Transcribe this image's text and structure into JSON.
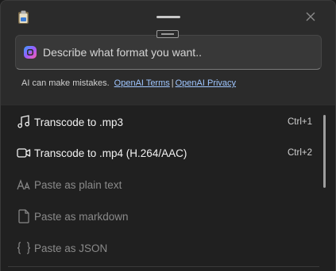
{
  "window": {
    "close_icon": "close-icon",
    "app_icon": "app-icon",
    "drag_handle": "drag-handle",
    "pin_icon": "pin-icon"
  },
  "prompt": {
    "placeholder": "Describe what format you want..",
    "value": "",
    "ai_icon": "ai-sparkle-icon"
  },
  "disclaimer": {
    "text": "AI can make mistakes.",
    "terms_link": "OpenAI Terms",
    "separator": "|",
    "privacy_link": "OpenAI Privacy"
  },
  "items": [
    {
      "label": "Transcode to .mp3",
      "shortcut": "Ctrl+1",
      "icon": "music-note-icon",
      "enabled": true
    },
    {
      "label": "Transcode to .mp4 (H.264/AAC)",
      "shortcut": "Ctrl+2",
      "icon": "video-camera-icon",
      "enabled": true
    },
    {
      "label": "Paste as plain text",
      "shortcut": "",
      "icon": "text-font-icon",
      "enabled": false
    },
    {
      "label": "Paste as markdown",
      "shortcut": "",
      "icon": "document-icon",
      "enabled": false
    },
    {
      "label": "Paste as JSON",
      "shortcut": "",
      "icon": "json-braces-icon",
      "enabled": false
    }
  ],
  "colors": {
    "window_bg": "#2b2b2b",
    "list_bg": "#202020",
    "link": "#9fc6ff",
    "disabled_text": "#8a8a8a"
  }
}
